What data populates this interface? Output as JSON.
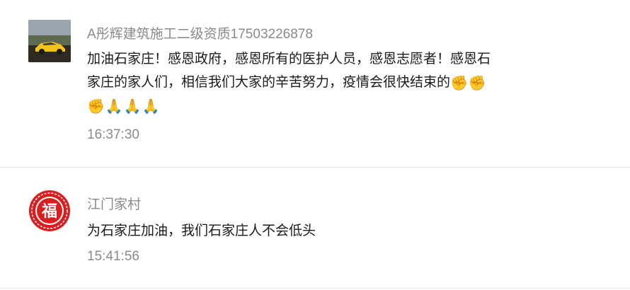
{
  "comments": [
    {
      "username": "A彤辉建筑施工二级资质17503226878",
      "text_line1": "加油石家庄！感恩政府，感恩所有的医护人员，感恩志愿者！感恩石",
      "text_line2": "家庄的家人们，相信我们大家的辛苦努力，疫情会很快结束的",
      "emojis_line2": [
        "✊",
        "✊"
      ],
      "emojis_line3": [
        "✊",
        "🙏",
        "🙏",
        "🙏"
      ],
      "time": "16:37:30",
      "avatar": "sports-car-avatar"
    },
    {
      "username": "江门家村",
      "text": "为石家庄加油，我们石家庄人不会低头",
      "time": "15:41:56",
      "avatar": "fu-papercut-avatar"
    }
  ],
  "colors": {
    "username": "#8a8a8a",
    "text": "#1a1a1a",
    "time": "#8a8a8a",
    "divider": "#e6e6e6",
    "fu_red": "#d81e1e"
  }
}
